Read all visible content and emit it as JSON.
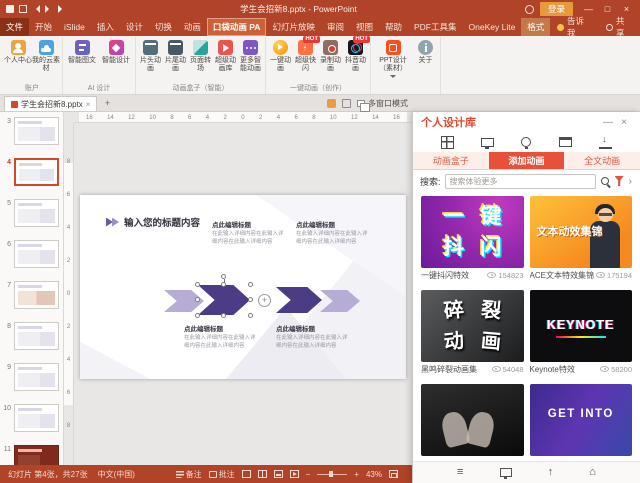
{
  "glyphs": {
    "min": "—",
    "max": "□",
    "close": "×",
    "plus": "+",
    "tab_close": "×",
    "add_tab": "+",
    "menu": "≡",
    "home": "⌂",
    "up": "↑",
    "zoom_out": "−",
    "zoom_in": "+"
  },
  "titlebar": {
    "title": "学生会招新8.pptx - PowerPoint",
    "login": "登录"
  },
  "tabs": {
    "items": [
      {
        "label": "文件"
      },
      {
        "label": "开始"
      },
      {
        "label": "iSlide"
      },
      {
        "label": "插入"
      },
      {
        "label": "设计"
      },
      {
        "label": "切换"
      },
      {
        "label": "动画"
      },
      {
        "label": "口袋动画 PA"
      },
      {
        "label": "幻灯片放映"
      },
      {
        "label": "审阅"
      },
      {
        "label": "视图"
      },
      {
        "label": "帮助"
      },
      {
        "label": "PDF工具集"
      },
      {
        "label": "OneKey Lite"
      },
      {
        "label": "格式"
      }
    ],
    "tell_me": "告诉我",
    "share": "共享"
  },
  "ribbon": {
    "g1": {
      "label": "账户",
      "b1": "个人中心",
      "b2": "我的云素材"
    },
    "g2": {
      "label": "AI 设计",
      "b1": "智能图文",
      "b2": "智能设计"
    },
    "g3": {
      "label": "动画盒子（智能）",
      "b1": "片头动画",
      "b2": "片尾动画",
      "b3": "页面转场",
      "b4": "超级动画库",
      "b5": "更多智能动画"
    },
    "g4": {
      "label": "一键动画（创作）",
      "b1": "一键动画",
      "b2": "超级快闪",
      "b3": "录制动画",
      "b4": "抖音动画",
      "hot": "HOT"
    },
    "g5": {
      "label": "",
      "b1": "PPT设计（素材）",
      "b2": "关于"
    }
  },
  "doctab": {
    "name": "学生会招新8.pptx",
    "multi": "多窗口模式"
  },
  "thumbs": {
    "items": [
      {
        "num": "3"
      },
      {
        "num": "4"
      },
      {
        "num": "5"
      },
      {
        "num": "6"
      },
      {
        "num": "7"
      },
      {
        "num": "8"
      },
      {
        "num": "9"
      },
      {
        "num": "10"
      },
      {
        "num": "11"
      }
    ]
  },
  "ruler": {
    "h": [
      "16",
      "14",
      "12",
      "10",
      "8",
      "6",
      "4",
      "2",
      "0",
      "2",
      "4",
      "6",
      "8",
      "10",
      "12",
      "14",
      "16"
    ],
    "v": [
      "8",
      "6",
      "4",
      "2",
      "0",
      "2",
      "4",
      "6",
      "8"
    ]
  },
  "slide": {
    "title": "输入您的标题内容",
    "blocks": [
      {
        "h": "点此编辑标题",
        "b": "在此输入详细内容在此输入详细内容在此输入详细内容"
      },
      {
        "h": "点此编辑标题",
        "b": "在此输入详细内容在此输入详细内容在此输入详细内容"
      },
      {
        "h": "点此编辑标题",
        "b": "在此输入详细内容在此输入详细内容在此输入详细内容"
      },
      {
        "h": "点此编辑标题",
        "b": "在此输入详细内容在此输入详细内容在此输入详细内容"
      }
    ]
  },
  "panel": {
    "title": "个人设计库",
    "tabs": [
      {
        "label": "动画盒子"
      },
      {
        "label": "添加动画"
      },
      {
        "label": "全文动画"
      }
    ],
    "search_label": "搜索:",
    "search_placeholder": "搜索体验更多",
    "cards": [
      {
        "caption": "一键抖闪特效",
        "views": "154823",
        "c1": "一",
        "c2": "键",
        "c3": "抖",
        "c4": "闪"
      },
      {
        "caption": "ACE文本特效集锦",
        "views": "175194",
        "art": "文本动效集锦"
      },
      {
        "caption": "黑鸣碎裂动画集",
        "views": "54048",
        "c1": "碎",
        "c2": "裂",
        "c3": "动",
        "c4": "画"
      },
      {
        "caption": "Keynote特效",
        "views": "58200",
        "art": "KEYNOTE"
      },
      {
        "caption": "",
        "views": "",
        "art": ""
      },
      {
        "caption": "",
        "views": "",
        "art": "GET INTO"
      }
    ]
  },
  "status": {
    "slide_info": "幻灯片 第4张，共27张",
    "lang": "中文(中国)",
    "notes": "备注",
    "comments": "批注",
    "zoom": "43%"
  }
}
